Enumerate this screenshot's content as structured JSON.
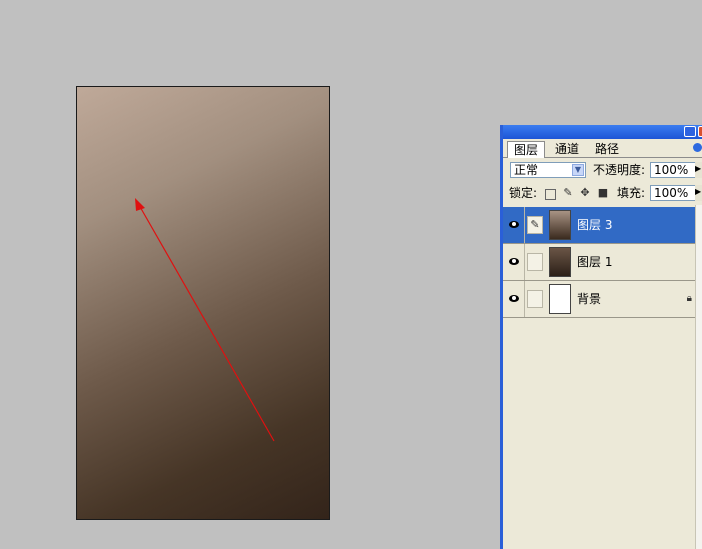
{
  "document_canvas": {
    "gradient_start": "#bfa999",
    "gradient_end": "#33241a",
    "arrow_color": "#e01010"
  },
  "layers_panel": {
    "tabs": [
      {
        "label": "图层",
        "active": true
      },
      {
        "label": "通道",
        "active": false
      },
      {
        "label": "路径",
        "active": false
      }
    ],
    "blend_mode": "正常",
    "opacity_label": "不透明度:",
    "opacity_value": "100%",
    "lock_label": "锁定:",
    "fill_label": "填充:",
    "fill_value": "100%",
    "lock_icons": [
      "transparency-lock-icon",
      "brush-lock-icon",
      "move-lock-icon",
      "padlock-icon"
    ],
    "layers": [
      {
        "name": "图层 3",
        "selected": true,
        "visible": true
      },
      {
        "name": "图层 1",
        "selected": false,
        "visible": true
      },
      {
        "name": "背景",
        "selected": false,
        "visible": true,
        "locked": true
      }
    ]
  },
  "colors": {
    "selection": "#316ac5",
    "title_bar": "#1d55d6",
    "workspace": "#c0c0c0"
  }
}
